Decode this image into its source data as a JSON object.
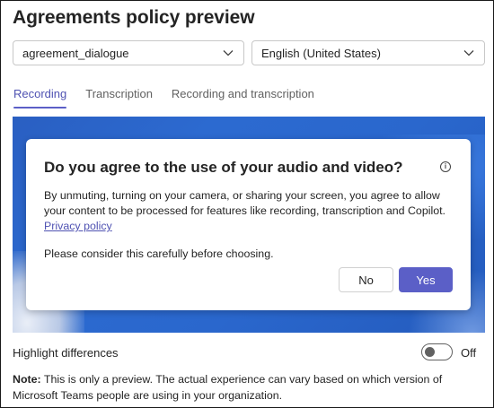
{
  "title": "Agreements policy preview",
  "dropdowns": {
    "policy": {
      "value": "agreement_dialogue"
    },
    "language": {
      "value": "English (United States)"
    }
  },
  "tabs": [
    {
      "label": "Recording",
      "active": true
    },
    {
      "label": "Transcription",
      "active": false
    },
    {
      "label": "Recording and transcription",
      "active": false
    }
  ],
  "dialog": {
    "title": "Do you agree to the use of your audio and video?",
    "body": "By unmuting, turning on your camera, or sharing your screen, you agree to allow your content to be processed for features like recording, transcription and Copilot.",
    "link": "Privacy policy",
    "note": "Please consider this carefully before choosing.",
    "no_label": "No",
    "yes_label": "Yes"
  },
  "highlight": {
    "label": "Highlight differences",
    "state": "Off"
  },
  "footer": {
    "note_label": "Note:",
    "note_text": "This is only a preview. The actual experience can vary based on which version of Microsoft Teams people are using in your organization."
  },
  "colors": {
    "accent": "#5b5fc7",
    "preview_background": "#2a64c8"
  },
  "icons": {
    "dropdown": "chevron-down-icon",
    "info": "info-icon"
  }
}
